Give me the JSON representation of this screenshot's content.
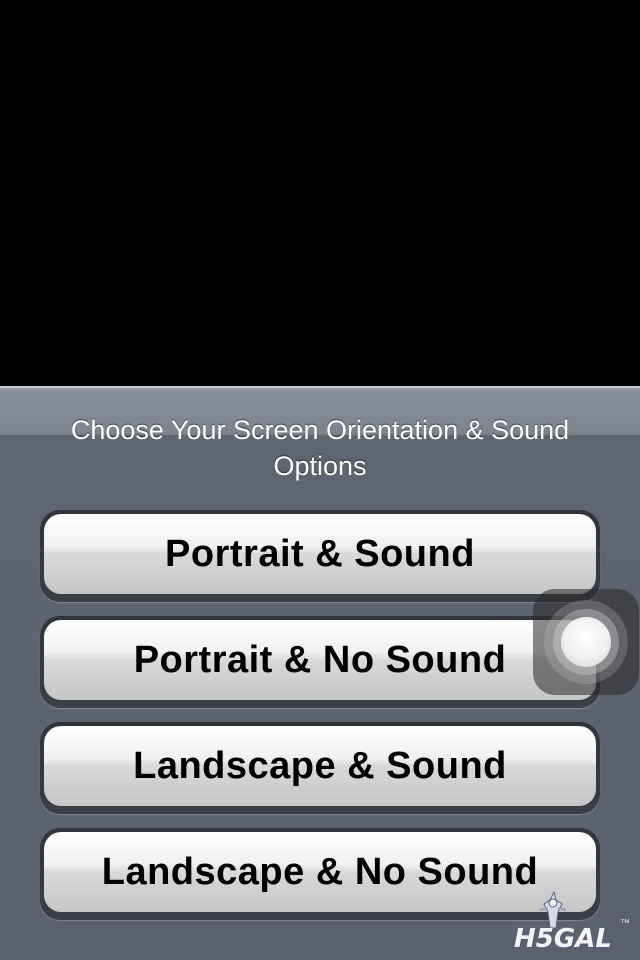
{
  "sheet": {
    "title": "Choose Your Screen Orientation & Sound Options"
  },
  "options": [
    {
      "label": "Portrait & Sound"
    },
    {
      "label": "Portrait & No Sound"
    },
    {
      "label": "Landscape & Sound"
    },
    {
      "label": "Landscape & No Sound"
    }
  ],
  "assistive_touch": {
    "icon": "assistive-touch-icon"
  },
  "watermark": {
    "text": "H5GAL",
    "trademark": "™"
  },
  "colors": {
    "sheet_background": "#5b616d",
    "button_text": "#000000",
    "title_text": "#ffffff"
  }
}
